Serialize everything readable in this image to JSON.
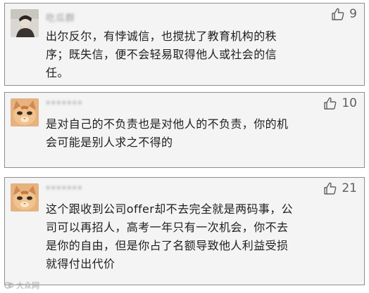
{
  "comments": [
    {
      "username": "吃瓜群",
      "likes": "9",
      "text": "出尔反尔，有悖诚信，也搅扰了教育机构的秩\n序；既失信，便不会轻易取得他人或社会的信\n任。"
    },
    {
      "username": "*******",
      "likes": "10",
      "text": "是对自己的不负责也是对他人的不负责，你的机\n会可能是别人求之不得的"
    },
    {
      "username": "*******",
      "likes": "21",
      "text": "这个跟收到公司offer却不去完全就是两码事，公\n司可以再招人，高考一年只有一次机会，你不去\n是你的自由，但是你占了名额导致他人利益受损\n就得付出代价"
    }
  ],
  "watermark": {
    "text": "大众网"
  },
  "icons": {
    "like": "thumbs-up-icon"
  },
  "colors": {
    "card_background": "#f4f4f4",
    "card_border": "#8e8e8e",
    "text": "#1e1e1e",
    "like_count": "#5f5f5f"
  }
}
